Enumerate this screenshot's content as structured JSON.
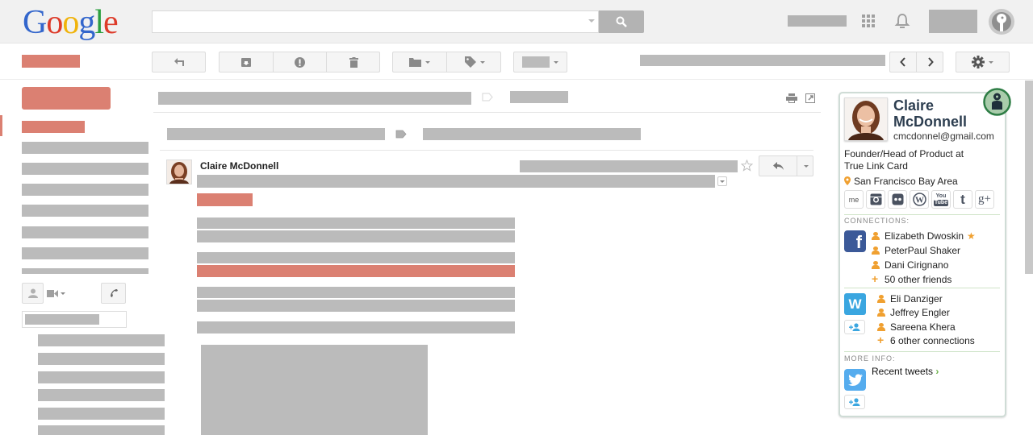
{
  "header": {
    "logo_letters": [
      {
        "ch": "G",
        "color": "#3366cc"
      },
      {
        "ch": "o",
        "color": "#dd3b2a"
      },
      {
        "ch": "o",
        "color": "#f0b30b"
      },
      {
        "ch": "g",
        "color": "#3366cc"
      },
      {
        "ch": "l",
        "color": "#2c9f40"
      },
      {
        "ch": "e",
        "color": "#dd3b2a"
      }
    ],
    "search_value": "",
    "icons": [
      "search-icon",
      "apps-grid-icon",
      "bell-icon",
      "account-avatar-icon"
    ]
  },
  "toolbar": {
    "buttons": [
      "back",
      "archive",
      "report-spam",
      "delete",
      "move-to",
      "labels",
      "more"
    ],
    "settings_icon": "gear-icon",
    "nav": [
      "prev",
      "next"
    ]
  },
  "message": {
    "sender_name": "Claire McDonnell",
    "icons": [
      "star-icon",
      "reply-icon",
      "more-caret-icon",
      "print-icon",
      "new-window-icon"
    ]
  },
  "profile_card": {
    "first_name": "Claire",
    "last_name": "McDonnell",
    "email": "cmcdonnel@gmail.com",
    "title_line1": "Founder/Head of Product at",
    "title_line2": "True Link Card",
    "location": "San Francisco Bay Area",
    "social": [
      {
        "name": "aboutme",
        "glyph": "me"
      },
      {
        "name": "instagram",
        "glyph": "▣"
      },
      {
        "name": "flickr",
        "glyph": "●●"
      },
      {
        "name": "wordpress",
        "glyph": "W"
      },
      {
        "name": "youtube",
        "glyph": "You"
      },
      {
        "name": "tumblr",
        "glyph": "t"
      },
      {
        "name": "googleplus",
        "glyph": "g+"
      }
    ],
    "connections_label": "CONNECTIONS:",
    "facebook": {
      "glyph": "f",
      "people": [
        "Elizabeth Dwoskin",
        "PeterPaul Shaker",
        "Dani Cirignano"
      ],
      "more": "50 other friends"
    },
    "other_network": {
      "glyph": "W",
      "people": [
        "Eli Danziger",
        "Jeffrey Engler",
        "Sareena Khera"
      ],
      "more": "6 other connections"
    },
    "more_info_label": "MORE INFO:",
    "twitter": {
      "glyph": "❦",
      "link": "Recent tweets",
      "chevron": "›"
    }
  },
  "colors": {
    "accent_red": "#db8072",
    "placeholder_gray": "#bbbbbb",
    "card_name": "#2d3e50",
    "orange": "#f0a030",
    "facebook": "#3b5998",
    "twitter": "#55acee",
    "w_blue": "#3aa6e0",
    "chevron_green": "#6bb24a"
  }
}
